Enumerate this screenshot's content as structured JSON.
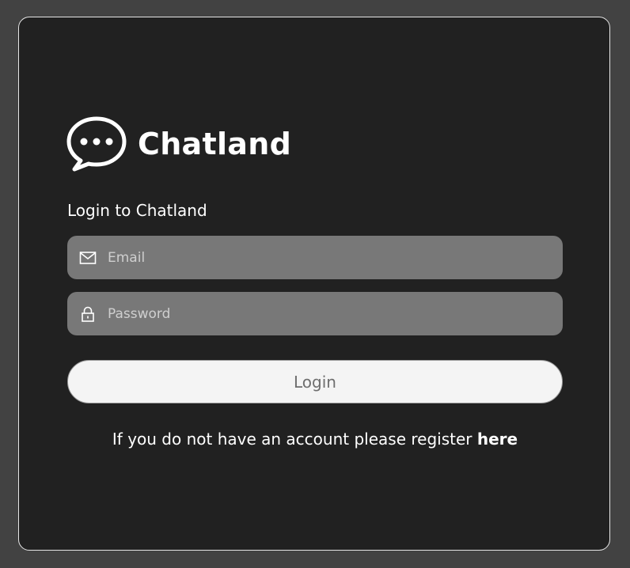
{
  "brand": {
    "name": "Chatland",
    "icon": "chat-bubble-icon"
  },
  "login": {
    "heading": "Login to Chatland",
    "email_placeholder": "Email",
    "email_icon": "mail-icon",
    "password_placeholder": "Password",
    "password_icon": "lock-icon",
    "button_label": "Login"
  },
  "register": {
    "text": "If you do not have an account please register ",
    "link_label": "here"
  },
  "colors": {
    "page_background": "#424242",
    "card_background": "#212121",
    "input_background": "#787878",
    "button_background": "#f4f4f4",
    "text": "#ffffff"
  }
}
